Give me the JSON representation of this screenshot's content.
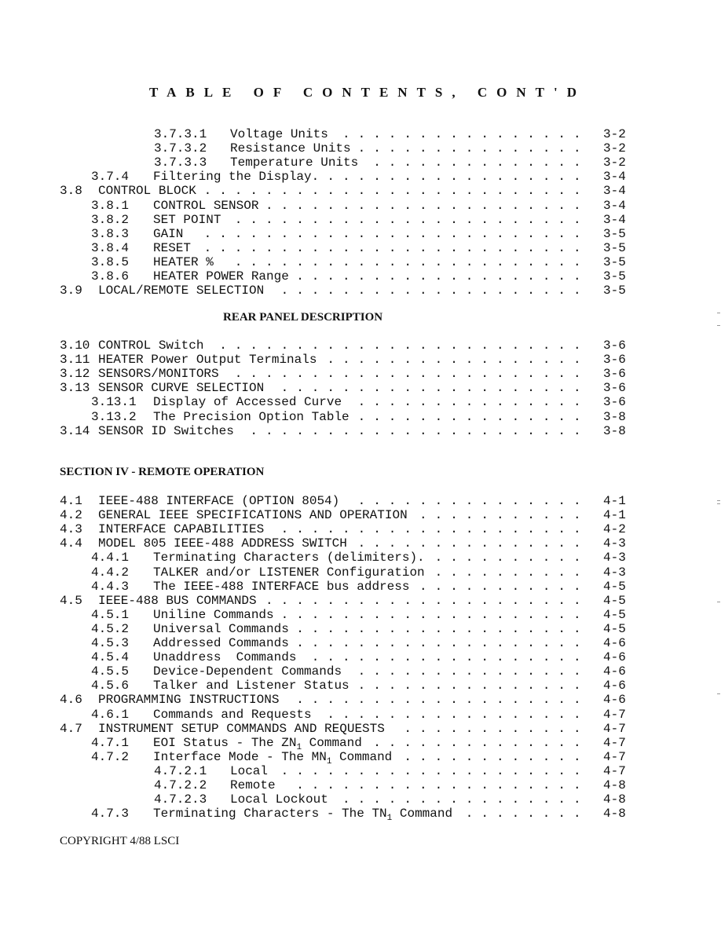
{
  "title": "TABLE OF CONTENTS, CONT'D",
  "headings": {
    "rear_panel": "REAR PANEL DESCRIPTION",
    "section_iv": "SECTION IV - REMOTE OPERATION"
  },
  "entries_front": [
    {
      "level": 3,
      "num": "3.7.3.1",
      "text": "Voltage Units",
      "page": "3-2"
    },
    {
      "level": 3,
      "num": "3.7.3.2",
      "text": "Resistance Units",
      "page": "3-2"
    },
    {
      "level": 3,
      "num": "3.7.3.3",
      "text": "Temperature Units",
      "page": "3-2"
    },
    {
      "level": 2,
      "num": "3.7.4",
      "text": "Filtering the Display.",
      "page": "3-4"
    },
    {
      "level": 1,
      "num": "3.8",
      "text": "CONTROL BLOCK",
      "page": "3-4"
    },
    {
      "level": 2,
      "num": "3.8.1",
      "text": "CONTROL SENSOR",
      "page": "3-4"
    },
    {
      "level": 2,
      "num": "3.8.2",
      "text": "SET POINT",
      "page": "3-4"
    },
    {
      "level": 2,
      "num": "3.8.3",
      "text": "GAIN",
      "page": "3-5"
    },
    {
      "level": 2,
      "num": "3.8.4",
      "text": "RESET",
      "page": "3-5"
    },
    {
      "level": 2,
      "num": "3.8.5",
      "text": "HEATER %",
      "page": "3-5"
    },
    {
      "level": 2,
      "num": "3.8.6",
      "text": "HEATER POWER Range",
      "page": "3-5"
    },
    {
      "level": 1,
      "num": "3.9",
      "text": "LOCAL/REMOTE SELECTION",
      "page": "3-5"
    }
  ],
  "entries_rear": [
    {
      "level": 1,
      "num": "3.10",
      "text": "CONTROL Switch",
      "page": "3-6"
    },
    {
      "level": 1,
      "num": "3.11",
      "text": "HEATER Power Output Terminals",
      "page": "3-6"
    },
    {
      "level": 1,
      "num": "3.12",
      "text": "SENSORS/MONITORS",
      "page": "3-6"
    },
    {
      "level": 1,
      "num": "3.13",
      "text": "SENSOR CURVE SELECTION",
      "page": "3-6"
    },
    {
      "level": 2,
      "num": "3.13.1",
      "text": "Display of Accessed Curve",
      "page": "3-6"
    },
    {
      "level": 2,
      "num": "3.13.2",
      "text": "The Precision Option Table",
      "page": "3-8"
    },
    {
      "level": 1,
      "num": "3.14",
      "text": "SENSOR ID Switches",
      "page": "3-8"
    }
  ],
  "entries_remote": [
    {
      "level": 1,
      "num": "4.1",
      "text": "IEEE-488 INTERFACE (OPTION 8054)",
      "page": "4-1"
    },
    {
      "level": 1,
      "num": "4.2",
      "text": "GENERAL IEEE SPECIFICATIONS AND OPERATION",
      "page": "4-1"
    },
    {
      "level": 1,
      "num": "4.3",
      "text": "INTERFACE CAPABILITIES",
      "page": "4-2"
    },
    {
      "level": 1,
      "num": "4.4",
      "text": "MODEL 805 IEEE-488 ADDRESS SWITCH",
      "page": "4-3"
    },
    {
      "level": 2,
      "num": "4.4.1",
      "text": "Terminating Characters (delimiters).",
      "page": "4-3"
    },
    {
      "level": 2,
      "num": "4.4.2",
      "text": "TALKER and/or LISTENER Configuration",
      "page": "4-3"
    },
    {
      "level": 2,
      "num": "4.4.3",
      "text": "The IEEE-488 INTERFACE bus address",
      "page": "4-5"
    },
    {
      "level": 1,
      "num": "4.5",
      "text": "IEEE-488 BUS COMMANDS",
      "page": "4-5"
    },
    {
      "level": 2,
      "num": "4.5.1",
      "text": "Uniline Commands",
      "page": "4-5"
    },
    {
      "level": 2,
      "num": "4.5.2",
      "text": "Universal Commands",
      "page": "4-5"
    },
    {
      "level": 2,
      "num": "4.5.3",
      "text": "Addressed Commands",
      "page": "4-6"
    },
    {
      "level": 2,
      "num": "4.5.4",
      "text": "Unaddress  Commands",
      "page": "4-6"
    },
    {
      "level": 2,
      "num": "4.5.5",
      "text": "Device-Dependent Commands",
      "page": "4-6"
    },
    {
      "level": 2,
      "num": "4.5.6",
      "text": "Talker and Listener Status",
      "page": "4-6"
    },
    {
      "level": 1,
      "num": "4.6",
      "text": "PROGRAMMING INSTRUCTIONS",
      "page": "4-6"
    },
    {
      "level": 2,
      "num": "4.6.1",
      "text": "Commands and Requests",
      "page": "4-7"
    },
    {
      "level": 1,
      "num": "4.7",
      "text": "INSTRUMENT SETUP COMMANDS AND REQUESTS",
      "page": "4-7"
    },
    {
      "level": 2,
      "num": "4.7.1",
      "text": "EOI Status - The ZN",
      "sub": "1",
      "after": " Command",
      "page": "4-7"
    },
    {
      "level": 2,
      "num": "4.7.2",
      "text": "Interface Mode - The MN",
      "sub": "1",
      "after": " Command",
      "page": "4-7"
    },
    {
      "level": 3,
      "num": "4.7.2.1",
      "text": "Local",
      "page": "4-7"
    },
    {
      "level": 3,
      "num": "4.7.2.2",
      "text": "Remote",
      "page": "4-8"
    },
    {
      "level": 3,
      "num": "4.7.2.3",
      "text": "Local Lockout",
      "page": "4-8"
    },
    {
      "level": 2,
      "num": "4.7.3",
      "text": "Terminating Characters - The TN",
      "sub": "1",
      "after": " Command",
      "page": "4-8"
    }
  ],
  "footer": "COPYRIGHT 4/88 LSCI"
}
